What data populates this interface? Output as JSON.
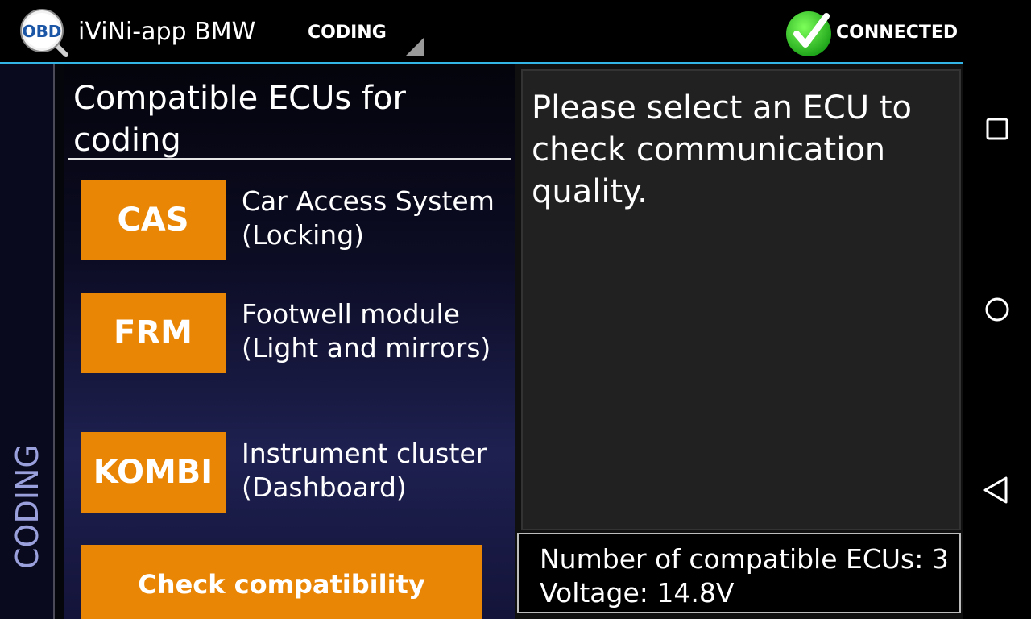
{
  "app": {
    "title": "iViNi-app BMW",
    "logo_text": "OBD",
    "logo_icon": "obd-magnifier-icon"
  },
  "mode_spinner": {
    "selected": "CODING"
  },
  "connection": {
    "status": "CONNECTED",
    "icon": "green-check-icon"
  },
  "side_tab": {
    "label": "CODING"
  },
  "left_panel": {
    "title": "Compatible ECUs for coding",
    "ecus": [
      {
        "code": "CAS",
        "description": "Car Access System (Locking)"
      },
      {
        "code": "FRM",
        "description": "Footwell module (Light and mirrors)"
      },
      {
        "code": "KOMBI",
        "description": "Instrument cluster (Dashboard)"
      }
    ],
    "check_button": "Check compatibility"
  },
  "right_panel": {
    "message": "Please select an ECU to check communication quality.",
    "status": {
      "ecu_count": "Number of compatible ECUs: 3",
      "voltage": "Voltage: 14.8V"
    }
  },
  "colors": {
    "accent_orange": "#ea8606",
    "highlight_blue": "#33b5e5",
    "connected_green": "#4cd137"
  },
  "nav": {
    "recents": "square-icon",
    "home": "circle-icon",
    "back": "triangle-back-icon"
  }
}
